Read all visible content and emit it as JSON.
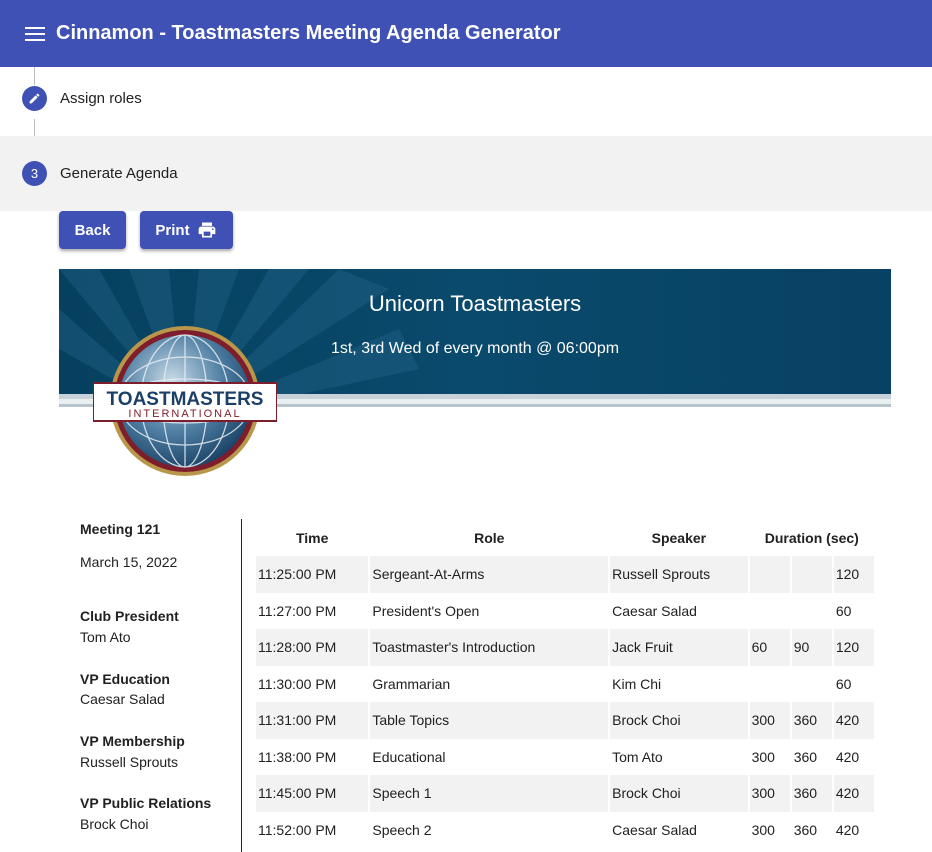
{
  "app": {
    "title": "Cinnamon - Toastmasters Meeting Agenda Generator"
  },
  "stepper": {
    "step2_label": "Assign roles",
    "step3_number": "3",
    "step3_label": "Generate Agenda"
  },
  "buttons": {
    "back_label": "Back",
    "print_label": "Print"
  },
  "banner": {
    "club_name": "Unicorn Toastmasters",
    "schedule": "1st, 3rd Wed of every month @ 06:00pm",
    "logo_text_top": "TOASTMASTERS",
    "logo_text_bottom": "INTERNATIONAL"
  },
  "meeting": {
    "number": "Meeting 121",
    "date": "March 15, 2022"
  },
  "officers": [
    {
      "title": "Club President",
      "name": "Tom Ato"
    },
    {
      "title": "VP Education",
      "name": "Caesar Salad"
    },
    {
      "title": "VP Membership",
      "name": "Russell Sprouts"
    },
    {
      "title": "VP Public Relations",
      "name": "Brock Choi"
    }
  ],
  "agenda": {
    "headers": {
      "time": "Time",
      "role": "Role",
      "speaker": "Speaker",
      "duration": "Duration (sec)"
    },
    "rows": [
      {
        "time": "11:25:00 PM",
        "role": "Sergeant-At-Arms",
        "speaker": "Russell Sprouts",
        "d1": "",
        "d2": "",
        "d3": "120"
      },
      {
        "time": "11:27:00 PM",
        "role": "President's Open",
        "speaker": "Caesar Salad",
        "d1": "",
        "d2": "",
        "d3": "60"
      },
      {
        "time": "11:28:00 PM",
        "role": "Toastmaster's Introduction",
        "speaker": "Jack Fruit",
        "d1": "60",
        "d2": "90",
        "d3": "120"
      },
      {
        "time": "11:30:00 PM",
        "role": "Grammarian",
        "speaker": "Kim Chi",
        "d1": "",
        "d2": "",
        "d3": "60"
      },
      {
        "time": "11:31:00 PM",
        "role": "Table Topics",
        "speaker": "Brock Choi",
        "d1": "300",
        "d2": "360",
        "d3": "420"
      },
      {
        "time": "11:38:00 PM",
        "role": "Educational",
        "speaker": "Tom Ato",
        "d1": "300",
        "d2": "360",
        "d3": "420"
      },
      {
        "time": "11:45:00 PM",
        "role": "Speech 1",
        "speaker": "Brock Choi",
        "d1": "300",
        "d2": "360",
        "d3": "420"
      },
      {
        "time": "11:52:00 PM",
        "role": "Speech 2",
        "speaker": "Caesar Salad",
        "d1": "300",
        "d2": "360",
        "d3": "420"
      }
    ]
  },
  "colors": {
    "primary": "#3f51b5",
    "banner": "#0a4a6c",
    "row_shade": "#f2f2f2"
  }
}
